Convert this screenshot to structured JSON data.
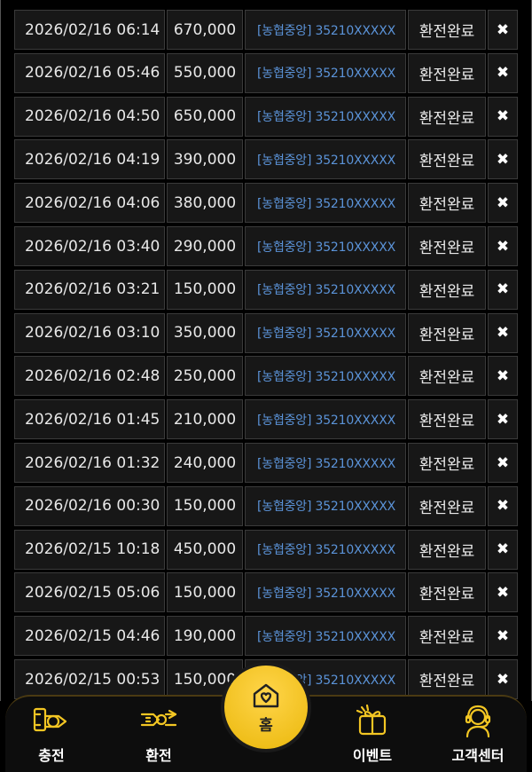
{
  "transactions": [
    {
      "date": "2026/02/16 06:14",
      "amount": "670,000",
      "account": "[농협중앙] 35210XXXXX",
      "status": "환전완료",
      "action": "✖"
    },
    {
      "date": "2026/02/16 05:46",
      "amount": "550,000",
      "account": "[농협중앙] 35210XXXXX",
      "status": "환전완료",
      "action": "✖"
    },
    {
      "date": "2026/02/16 04:50",
      "amount": "650,000",
      "account": "[농협중앙] 35210XXXXX",
      "status": "환전완료",
      "action": "✖"
    },
    {
      "date": "2026/02/16 04:19",
      "amount": "390,000",
      "account": "[농협중앙] 35210XXXXX",
      "status": "환전완료",
      "action": "✖"
    },
    {
      "date": "2026/02/16 04:06",
      "amount": "380,000",
      "account": "[농협중앙] 35210XXXXX",
      "status": "환전완료",
      "action": "✖"
    },
    {
      "date": "2026/02/16 03:40",
      "amount": "290,000",
      "account": "[농협중앙] 35210XXXXX",
      "status": "환전완료",
      "action": "✖"
    },
    {
      "date": "2026/02/16 03:21",
      "amount": "150,000",
      "account": "[농협중앙] 35210XXXXX",
      "status": "환전완료",
      "action": "✖"
    },
    {
      "date": "2026/02/16 03:10",
      "amount": "350,000",
      "account": "[농협중앙] 35210XXXXX",
      "status": "환전완료",
      "action": "✖"
    },
    {
      "date": "2026/02/16 02:48",
      "amount": "250,000",
      "account": "[농협중앙] 35210XXXXX",
      "status": "환전완료",
      "action": "✖"
    },
    {
      "date": "2026/02/16 01:45",
      "amount": "210,000",
      "account": "[농협중앙] 35210XXXXX",
      "status": "환전완료",
      "action": "✖"
    },
    {
      "date": "2026/02/16 01:32",
      "amount": "240,000",
      "account": "[농협중앙] 35210XXXXX",
      "status": "환전완료",
      "action": "✖"
    },
    {
      "date": "2026/02/16 00:30",
      "amount": "150,000",
      "account": "[농협중앙] 35210XXXXX",
      "status": "환전완료",
      "action": "✖"
    },
    {
      "date": "2026/02/15 10:18",
      "amount": "450,000",
      "account": "[농협중앙] 35210XXXXX",
      "status": "환전완료",
      "action": "✖"
    },
    {
      "date": "2026/02/15 05:06",
      "amount": "150,000",
      "account": "[농협중앙] 35210XXXXX",
      "status": "환전완료",
      "action": "✖"
    },
    {
      "date": "2026/02/15 04:46",
      "amount": "190,000",
      "account": "[농협중앙] 35210XXXXX",
      "status": "환전완료",
      "action": "✖"
    },
    {
      "date": "2026/02/15 00:53",
      "amount": "150,000",
      "account": "[농협중앙] 35210XXXXX",
      "status": "환전완료",
      "action": "✖"
    }
  ],
  "nav": {
    "deposit": {
      "label": "충전",
      "icon": "deposit-icon"
    },
    "withdraw": {
      "label": "환전",
      "icon": "withdraw-icon"
    },
    "home": {
      "label": "홈",
      "icon": "home-heart-icon"
    },
    "event": {
      "label": "이벤트",
      "icon": "gift-icon"
    },
    "support": {
      "label": "고객센터",
      "icon": "support-agent-icon"
    }
  },
  "colors": {
    "accent": "#f3c623",
    "account_link": "#5b93d8",
    "background": "#000000"
  }
}
